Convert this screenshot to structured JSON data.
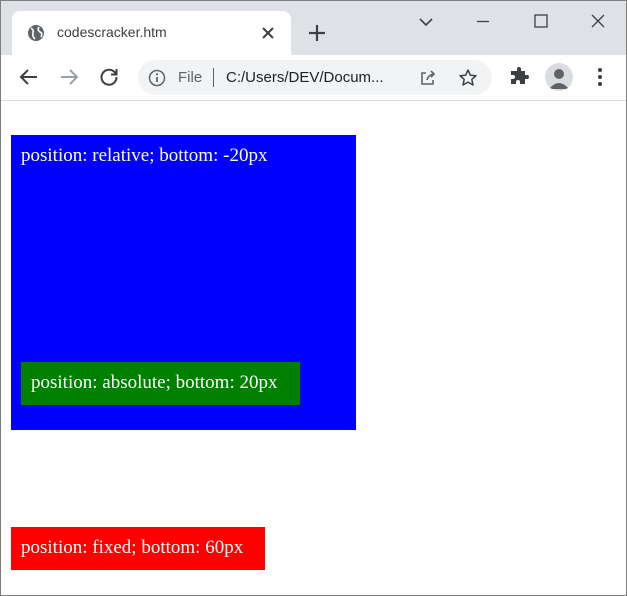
{
  "browser": {
    "tab_title": "codescracker.htm",
    "tab_icon": "globe-icon",
    "address_scheme": "File",
    "address_url": "C:/Users/DEV/Docum...",
    "colors": {
      "titlebar": "#dee1e6",
      "toolbar": "#ffffff",
      "omnibox": "#f1f3f4"
    }
  },
  "page": {
    "relative_box": {
      "label": "position: relative; bottom: -20px",
      "color": "#0000ff"
    },
    "absolute_box": {
      "label": "position: absolute; bottom: 20px",
      "color": "#008000"
    },
    "fixed_box": {
      "label": "position: fixed; bottom: 60px",
      "color": "#ff0000"
    }
  }
}
